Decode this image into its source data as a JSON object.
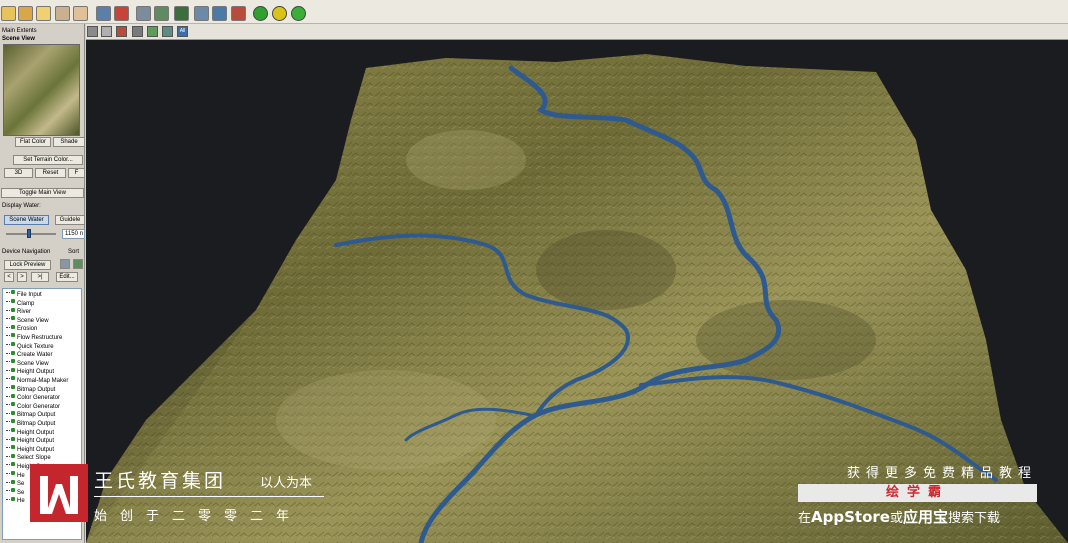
{
  "toolbar": {
    "icons": [
      "open-icon",
      "save-icon",
      "export-icon",
      "pin-icon",
      "hand-icon",
      "terrain-icon",
      "render-icon",
      "grid-icon",
      "table-icon",
      "calc-icon",
      "camera-icon",
      "image-icon",
      "green-light-icon",
      "yellow-light-icon",
      "green-go-icon"
    ],
    "colors": {
      "green": "#2ea12e",
      "yellow": "#d8c418"
    }
  },
  "left_panel": {
    "main_extents": "Main Extents",
    "scene_view": "Scene View",
    "flat_color": "Flat Color",
    "shaded": "Shade",
    "set_terrain_color": "Set Terrain Color...",
    "btn_3d": "3D",
    "reset": "Reset",
    "f_btn": "F",
    "toggle_main_view": "Toggle Main View",
    "display_water_label": "Display Water:",
    "scene_water": "Scene Water",
    "guideline": "Guidele",
    "water_value": "1150 n",
    "slider_level": 0.45,
    "device_navigation": "Device Navigation",
    "sort": "Sort",
    "lock_preview": "Lock Preview",
    "nav_prev": "<",
    "nav_next": ">",
    "nav_last": ">|",
    "edit": "Edit...",
    "tree": [
      "File Input",
      "Clamp",
      "River",
      "Scene View",
      "Erosion",
      "Flow Restructure",
      "Quick Texture",
      "Create Water",
      "Scene View",
      "Height Output",
      "Normal-Map Maker",
      "Bitmap Output",
      "Color Generator",
      "Color Generator",
      "Bitmap Output",
      "Bitmap Output",
      "Height Output",
      "Height Output",
      "Height Output",
      "Select Slope",
      "Height Output",
      "He",
      "Se",
      "Se",
      "He"
    ]
  },
  "viewport": {
    "toolbar_icons": [
      "persp-icon",
      "frame-icon",
      "material-icon",
      "light-icon",
      "slope-icon",
      "mesh-icon",
      "all-icon"
    ],
    "all_label": "All",
    "terrain_color": "#7f7a3e",
    "river_color": "#2f5a8f"
  },
  "watermark": {
    "org_name": "王氏教育集团",
    "motto": "以人为本",
    "since": "始创于二零零二年",
    "promo_line": "获得更多免费精品教程",
    "app_name": "绘学霸",
    "download_pre": "在",
    "download_appstore": "AppStore",
    "download_mid": "或",
    "download_store": "应用宝",
    "download_post": "搜索下载"
  }
}
